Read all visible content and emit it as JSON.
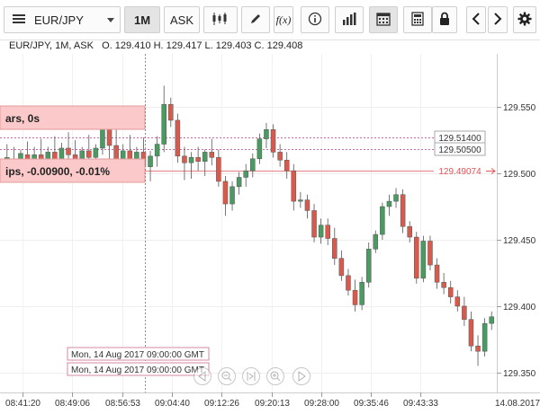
{
  "toolbar": {
    "symbol": "EUR/JPY",
    "timeframe": "1M",
    "side": "ASK",
    "fx_label": "f(x)"
  },
  "header": {
    "instrument": "EUR/JPY, 1M, ASK",
    "ohlc": "O. 129.410 H. 129.417 L. 129.403 C. 129.408"
  },
  "overlay": {
    "box1_text": "ars, 0s",
    "box2_text": "ips, -0.00900, -0.01%"
  },
  "price_axis": {
    "ticks": [
      "129.550",
      "129.500",
      "129.450",
      "129.400",
      "129.350"
    ],
    "tag_upper": "129.51400",
    "tag_lower": "129.50500",
    "tag_current": "129.49074"
  },
  "time_axis": {
    "ticks": [
      "08:41:20",
      "08:49:06",
      "08:56:53",
      "09:04:40",
      "09:12:26",
      "09:20:13",
      "09:28:00",
      "09:35:46",
      "09:43:33"
    ],
    "date_label": "14.08.2017"
  },
  "crosshair_labels": {
    "upper": "Mon, 14 Aug 2017 09:00:00 GMT",
    "lower": "Mon, 14 Aug 2017 09:00:00 GMT"
  },
  "colors": {
    "bull": "#4a9a62",
    "bear": "#d95a4c",
    "current_price": "#e0545a",
    "overlay_fill": "#fbc9c9",
    "crosshair": "#c868a8"
  },
  "chart_data": {
    "type": "candlestick",
    "ylim": [
      129.335,
      129.59
    ],
    "yticks": [
      129.55,
      129.5,
      129.45,
      129.4,
      129.35
    ],
    "candles": [
      {
        "o": 129.51,
        "h": 129.522,
        "l": 129.498,
        "c": 129.512
      },
      {
        "o": 129.511,
        "h": 129.52,
        "l": 129.5,
        "c": 129.505
      },
      {
        "o": 129.505,
        "h": 129.518,
        "l": 129.498,
        "c": 129.515
      },
      {
        "o": 129.514,
        "h": 129.524,
        "l": 129.502,
        "c": 129.508
      },
      {
        "o": 129.508,
        "h": 129.52,
        "l": 129.496,
        "c": 129.514
      },
      {
        "o": 129.514,
        "h": 129.526,
        "l": 129.503,
        "c": 129.507
      },
      {
        "o": 129.507,
        "h": 129.52,
        "l": 129.5,
        "c": 129.516
      },
      {
        "o": 129.516,
        "h": 129.528,
        "l": 129.505,
        "c": 129.511
      },
      {
        "o": 129.511,
        "h": 129.523,
        "l": 129.501,
        "c": 129.519
      },
      {
        "o": 129.519,
        "h": 129.531,
        "l": 129.51,
        "c": 129.514
      },
      {
        "o": 129.514,
        "h": 129.525,
        "l": 129.504,
        "c": 129.509
      },
      {
        "o": 129.509,
        "h": 129.52,
        "l": 129.498,
        "c": 129.517
      },
      {
        "o": 129.517,
        "h": 129.529,
        "l": 129.508,
        "c": 129.512
      },
      {
        "o": 129.512,
        "h": 129.522,
        "l": 129.502,
        "c": 129.519
      },
      {
        "o": 129.519,
        "h": 129.54,
        "l": 129.514,
        "c": 129.536
      },
      {
        "o": 129.536,
        "h": 129.546,
        "l": 129.5,
        "c": 129.521
      },
      {
        "o": 129.521,
        "h": 129.534,
        "l": 129.506,
        "c": 129.511
      },
      {
        "o": 129.511,
        "h": 129.522,
        "l": 129.501,
        "c": 129.517
      },
      {
        "o": 129.517,
        "h": 129.529,
        "l": 129.507,
        "c": 129.509
      },
      {
        "o": 129.509,
        "h": 129.52,
        "l": 129.498,
        "c": 129.516
      },
      {
        "o": 129.516,
        "h": 129.527,
        "l": 129.506,
        "c": 129.505
      },
      {
        "o": 129.505,
        "h": 129.517,
        "l": 129.494,
        "c": 129.513
      },
      {
        "o": 129.513,
        "h": 129.528,
        "l": 129.505,
        "c": 129.522
      },
      {
        "o": 129.522,
        "h": 129.566,
        "l": 129.516,
        "c": 129.552
      },
      {
        "o": 129.552,
        "h": 129.557,
        "l": 129.535,
        "c": 129.54
      },
      {
        "o": 129.54,
        "h": 129.545,
        "l": 129.508,
        "c": 129.513
      },
      {
        "o": 129.513,
        "h": 129.52,
        "l": 129.495,
        "c": 129.508
      },
      {
        "o": 129.508,
        "h": 129.516,
        "l": 129.496,
        "c": 129.512
      },
      {
        "o": 129.512,
        "h": 129.52,
        "l": 129.502,
        "c": 129.509
      },
      {
        "o": 129.509,
        "h": 129.518,
        "l": 129.498,
        "c": 129.516
      },
      {
        "o": 129.516,
        "h": 129.526,
        "l": 129.506,
        "c": 129.512
      },
      {
        "o": 129.512,
        "h": 129.518,
        "l": 129.49,
        "c": 129.494
      },
      {
        "o": 129.494,
        "h": 129.498,
        "l": 129.468,
        "c": 129.477
      },
      {
        "o": 129.477,
        "h": 129.494,
        "l": 129.472,
        "c": 129.49
      },
      {
        "o": 129.49,
        "h": 129.501,
        "l": 129.484,
        "c": 129.497
      },
      {
        "o": 129.497,
        "h": 129.507,
        "l": 129.49,
        "c": 129.502
      },
      {
        "o": 129.502,
        "h": 129.515,
        "l": 129.497,
        "c": 129.511
      },
      {
        "o": 129.511,
        "h": 129.53,
        "l": 129.507,
        "c": 129.526
      },
      {
        "o": 129.526,
        "h": 129.538,
        "l": 129.519,
        "c": 129.533
      },
      {
        "o": 129.533,
        "h": 129.537,
        "l": 129.512,
        "c": 129.516
      },
      {
        "o": 129.516,
        "h": 129.522,
        "l": 129.505,
        "c": 129.51
      },
      {
        "o": 129.51,
        "h": 129.516,
        "l": 129.496,
        "c": 129.502
      },
      {
        "o": 129.502,
        "h": 129.507,
        "l": 129.472,
        "c": 129.479
      },
      {
        "o": 129.479,
        "h": 129.486,
        "l": 129.474,
        "c": 129.48
      },
      {
        "o": 129.48,
        "h": 129.484,
        "l": 129.466,
        "c": 129.472
      },
      {
        "o": 129.472,
        "h": 129.477,
        "l": 129.448,
        "c": 129.452
      },
      {
        "o": 129.452,
        "h": 129.466,
        "l": 129.447,
        "c": 129.461
      },
      {
        "o": 129.461,
        "h": 129.466,
        "l": 129.446,
        "c": 129.451
      },
      {
        "o": 129.451,
        "h": 129.459,
        "l": 129.431,
        "c": 129.436
      },
      {
        "o": 129.436,
        "h": 129.442,
        "l": 129.419,
        "c": 129.423
      },
      {
        "o": 129.423,
        "h": 129.428,
        "l": 129.408,
        "c": 129.412
      },
      {
        "o": 129.412,
        "h": 129.42,
        "l": 129.396,
        "c": 129.401
      },
      {
        "o": 129.401,
        "h": 129.422,
        "l": 129.397,
        "c": 129.418
      },
      {
        "o": 129.418,
        "h": 129.448,
        "l": 129.414,
        "c": 129.443
      },
      {
        "o": 129.443,
        "h": 129.457,
        "l": 129.44,
        "c": 129.454
      },
      {
        "o": 129.454,
        "h": 129.478,
        "l": 129.45,
        "c": 129.475
      },
      {
        "o": 129.475,
        "h": 129.484,
        "l": 129.468,
        "c": 129.479
      },
      {
        "o": 129.479,
        "h": 129.489,
        "l": 129.474,
        "c": 129.484
      },
      {
        "o": 129.484,
        "h": 129.488,
        "l": 129.455,
        "c": 129.46
      },
      {
        "o": 129.46,
        "h": 129.464,
        "l": 129.448,
        "c": 129.452
      },
      {
        "o": 129.452,
        "h": 129.456,
        "l": 129.417,
        "c": 129.421
      },
      {
        "o": 129.421,
        "h": 129.453,
        "l": 129.418,
        "c": 129.449
      },
      {
        "o": 129.449,
        "h": 129.453,
        "l": 129.427,
        "c": 129.431
      },
      {
        "o": 129.431,
        "h": 129.436,
        "l": 129.413,
        "c": 129.418
      },
      {
        "o": 129.418,
        "h": 129.425,
        "l": 129.409,
        "c": 129.414
      },
      {
        "o": 129.414,
        "h": 129.419,
        "l": 129.402,
        "c": 129.407
      },
      {
        "o": 129.407,
        "h": 129.412,
        "l": 129.396,
        "c": 129.4
      },
      {
        "o": 129.4,
        "h": 129.407,
        "l": 129.385,
        "c": 129.39
      },
      {
        "o": 129.39,
        "h": 129.396,
        "l": 129.366,
        "c": 129.37
      },
      {
        "o": 129.37,
        "h": 129.378,
        "l": 129.355,
        "c": 129.366
      },
      {
        "o": 129.366,
        "h": 129.391,
        "l": 129.362,
        "c": 129.387
      },
      {
        "o": 129.387,
        "h": 129.396,
        "l": 129.382,
        "c": 129.392
      }
    ]
  }
}
